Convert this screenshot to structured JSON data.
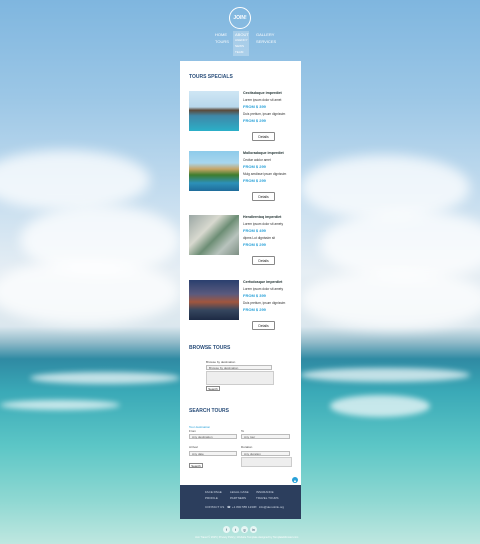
{
  "logo": "JOIN!",
  "nav": {
    "home": "HOME",
    "about": "ABOUT",
    "gallery": "GALLERY",
    "tours": "TOURS",
    "services": "SERVICES",
    "sub": [
      "AGENCY",
      "NEWS",
      "TEAM"
    ]
  },
  "specials": {
    "title": "TOURS SPECIALS",
    "details_label": "Details",
    "tours": [
      {
        "name": "Cecitsdoque imperdiet",
        "line1": "Lorem ipsum dolor sit amet",
        "price1": "FROM $ 399",
        "line2": "Duis pretium, ipsum dignissim",
        "price2": "FROM $ 299"
      },
      {
        "name": "Molloradoque imperdiet",
        "line1": "Cecitar adolor amet",
        "price1": "FROM $ 299",
        "line2": "Mulg amdisse ipsum dignissim",
        "price2": "FROM $ 299"
      },
      {
        "name": "Hendlerntoq imperdiet",
        "line1": "Lorem ipsum dolor sit amety",
        "price1": "FROM $ 499",
        "line2": "dipms Lut dignissim sit",
        "price2": "FROM $ 299"
      },
      {
        "name": "Cerfodosque imperdiet",
        "line1": "Lorem ipsum dolor sit amety",
        "price1": "FROM $ 399",
        "line2": "Duis pretium, ipsum dignissim",
        "price2": "FROM $ 299"
      }
    ]
  },
  "browse": {
    "title": "BROWSE TOURS",
    "label": "Browse by destination",
    "select": "Browse by destination",
    "button": "Search"
  },
  "search": {
    "title": "SEARCH TOURS",
    "label_dest": "Tour destination",
    "label_from": "From",
    "label_to": "To",
    "label_arrival": "Arrival",
    "label_duration": "Duration",
    "sel1": "Any destination",
    "sel2": "Any tour",
    "sel3": "Any date",
    "sel4": "Any duration",
    "button": "Search"
  },
  "footer": {
    "col1": [
      "FACE PAGE",
      "PROFILE",
      "CONTACT US"
    ],
    "col2": [
      "LEGAL CASE",
      "PARTNERS"
    ],
    "col3": [
      "INSURANCE",
      "TRAVEL TOURS"
    ],
    "phone": "+1 800 555 1234",
    "email": "info@demolink.org"
  },
  "social": [
    "f",
    "t",
    "g",
    "in"
  ],
  "copyright": "Join Travel © 2015 | Privacy Policy | Website Template designed by TemplateMonster.com"
}
